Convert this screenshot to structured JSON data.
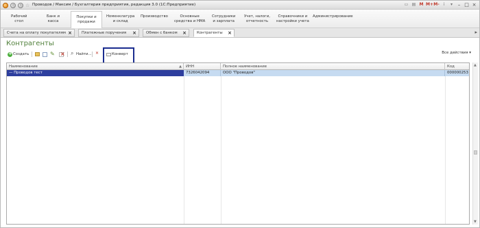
{
  "window": {
    "title": "Проводов / Максим / Бухгалтерия предприятия, редакция 3.0  (1С:Предприятие)",
    "right_icons": [
      "M",
      "M+",
      "M-"
    ],
    "colors": {
      "accent_green": "#4f7f39",
      "selection": "#2d3e9e",
      "highlight_box": "#1a2c8f"
    }
  },
  "sections": [
    {
      "line1": "Рабочий",
      "line2": "стол"
    },
    {
      "line1": "Банк и",
      "line2": "касса"
    },
    {
      "line1": "Покупки и",
      "line2": "продажи"
    },
    {
      "line1": "Номенклатура",
      "line2": "и склад"
    },
    {
      "line1": "Производство",
      "line2": ""
    },
    {
      "line1": "Основные",
      "line2": "средства и НМА"
    },
    {
      "line1": "Сотрудники",
      "line2": "и зарплата"
    },
    {
      "line1": "Учет, налоги,",
      "line2": "отчетность"
    },
    {
      "line1": "Справочники и",
      "line2": "настройки учета"
    },
    {
      "line1": "Администрирование",
      "line2": ""
    }
  ],
  "open_tabs": [
    {
      "label": "Счета на оплату покупателям"
    },
    {
      "label": "Платежные поручения"
    },
    {
      "label": "Обмен с банком"
    },
    {
      "label": "Контрагенты"
    }
  ],
  "form": {
    "title": "Контрагенты",
    "toolbar": {
      "create_label": "Создать",
      "find_label": "Найти...",
      "envelope_label": "Конверт",
      "all_actions_label": "Все действия",
      "dropdown_arrow": "▾"
    },
    "table": {
      "columns": [
        "Наименование",
        "ИНН",
        "Полное наименование",
        "Код"
      ],
      "rows": [
        {
          "name": "Проводов тест",
          "inn": "7326042094",
          "full_name": "ООО \"Проводов\"",
          "code": "000000253"
        }
      ]
    }
  }
}
